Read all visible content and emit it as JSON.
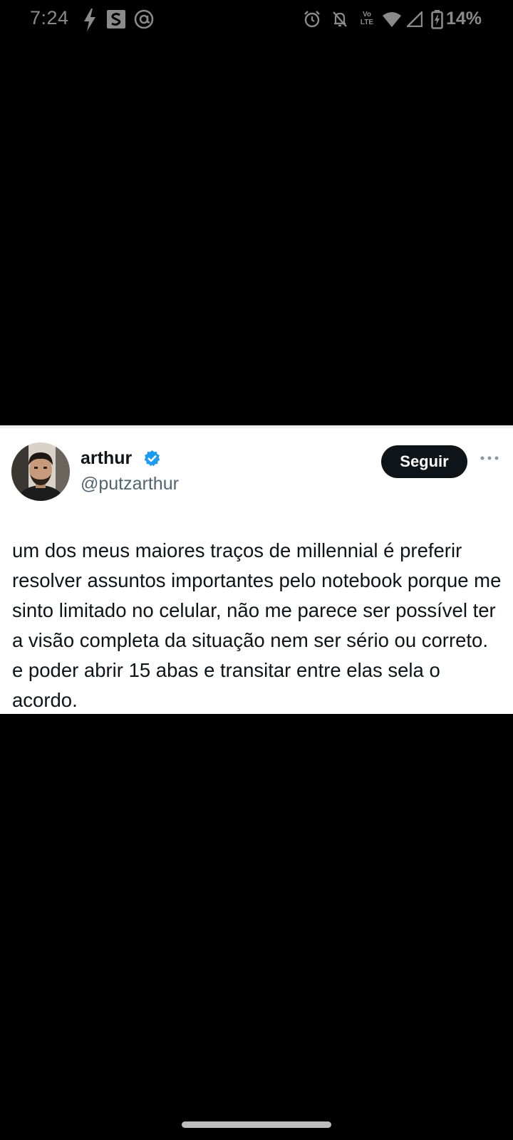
{
  "status_bar": {
    "time": "7:24",
    "battery": "14%",
    "left_icons": [
      "flash-icon",
      "s-app-icon",
      "at-sign-icon"
    ],
    "right_icons": [
      "alarm-icon",
      "mute-icon",
      "volte-lte-icon",
      "wifi-icon",
      "cell-signal-icon",
      "battery-icon"
    ],
    "volte_label_top": "Vo",
    "volte_label_bottom": "LTE"
  },
  "tweet": {
    "display_name": "arthur",
    "handle": "@putzarthur",
    "verified": true,
    "follow_label": "Seguir",
    "text": "um dos meus maiores traços de millennial é preferir resolver assuntos importantes pelo notebook porque me sinto limitado no celular, não me parece ser possível ter a visão completa da situação nem ser sério ou correto. e poder abrir 15 abas e transitar entre elas sela o acordo.",
    "colors": {
      "verified_blue": "#1d9bf0",
      "button_bg": "#0f1419",
      "handle_gray": "#536471"
    }
  }
}
